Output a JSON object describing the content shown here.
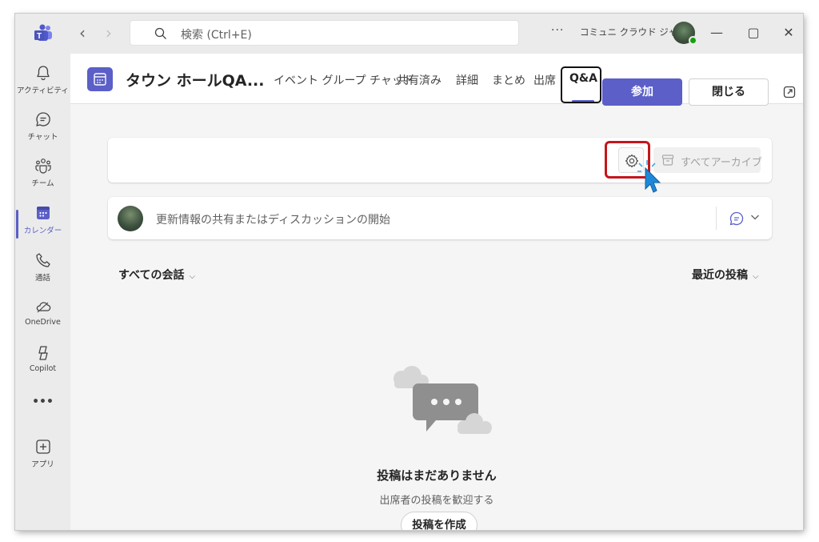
{
  "titlebar": {
    "search_placeholder": "検索 (Ctrl+E)",
    "more": "···",
    "org_name": "コミュニ クラウド ジャ...",
    "minimize": "—",
    "maximize": "▢",
    "close": "✕"
  },
  "rail": {
    "items": [
      {
        "label": "アクティビティ",
        "icon": "bell-icon"
      },
      {
        "label": "チャット",
        "icon": "chat-icon"
      },
      {
        "label": "チーム",
        "icon": "teams-icon"
      },
      {
        "label": "カレンダー",
        "icon": "calendar-icon"
      },
      {
        "label": "通話",
        "icon": "phone-icon"
      },
      {
        "label": "OneDrive",
        "icon": "cloud-icon"
      },
      {
        "label": "Copilot",
        "icon": "copilot-icon"
      },
      {
        "label": "•••",
        "icon": "more-icon"
      },
      {
        "label": "アプリ",
        "icon": "add-apps-icon"
      }
    ],
    "active_index": 3
  },
  "header": {
    "title": "タウン ホールQA...",
    "tabs": [
      {
        "label": "イベント グループ チャット"
      },
      {
        "label": "共有済み"
      },
      {
        "label": "詳細"
      },
      {
        "label": "まとめ"
      },
      {
        "label": "出席"
      },
      {
        "label": "Q&A"
      }
    ],
    "active_tab": "Q&A",
    "join_label": "参加",
    "close_label": "閉じる"
  },
  "toolbar": {
    "archive_all_label": "すべてアーカイブ"
  },
  "compose": {
    "placeholder": "更新情報の共有またはディスカッションの開始"
  },
  "filters": {
    "left": "すべての会話",
    "right": "最近の投稿",
    "chevron": "⌵"
  },
  "empty": {
    "title": "投稿はまだありません",
    "subtitle": "出席者の投稿を歓迎する",
    "create_label": "投稿を作成"
  },
  "colors": {
    "accent": "#5b5fc7",
    "highlight_red": "#c4161c",
    "presence_green": "#13a10e"
  }
}
